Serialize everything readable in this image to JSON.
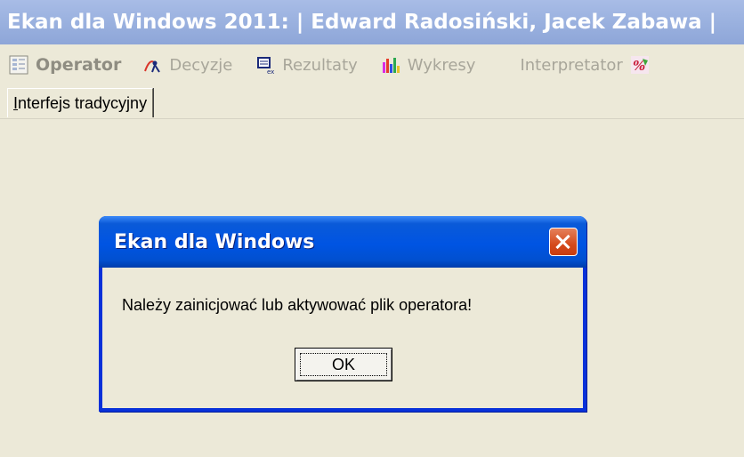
{
  "window": {
    "title": "Ekan dla Windows 2011:  | Edward Radosiński, Jacek Zabawa |"
  },
  "toolbar": {
    "items": [
      {
        "label": "Operator",
        "icon": "operator-icon"
      },
      {
        "label": "Decyzje",
        "icon": "decisions-icon"
      },
      {
        "label": "Rezultaty",
        "icon": "results-icon"
      },
      {
        "label": "Wykresy",
        "icon": "charts-icon"
      },
      {
        "label": "Interpretator",
        "icon": "interpreter-icon"
      }
    ]
  },
  "tabs": [
    {
      "label_acc": "I",
      "label_rest": "nterfejs tradycyjny"
    }
  ],
  "dialog": {
    "title": "Ekan dla Windows",
    "message": "Należy zainicjować lub aktywować plik operatora!",
    "ok_label": "OK"
  }
}
